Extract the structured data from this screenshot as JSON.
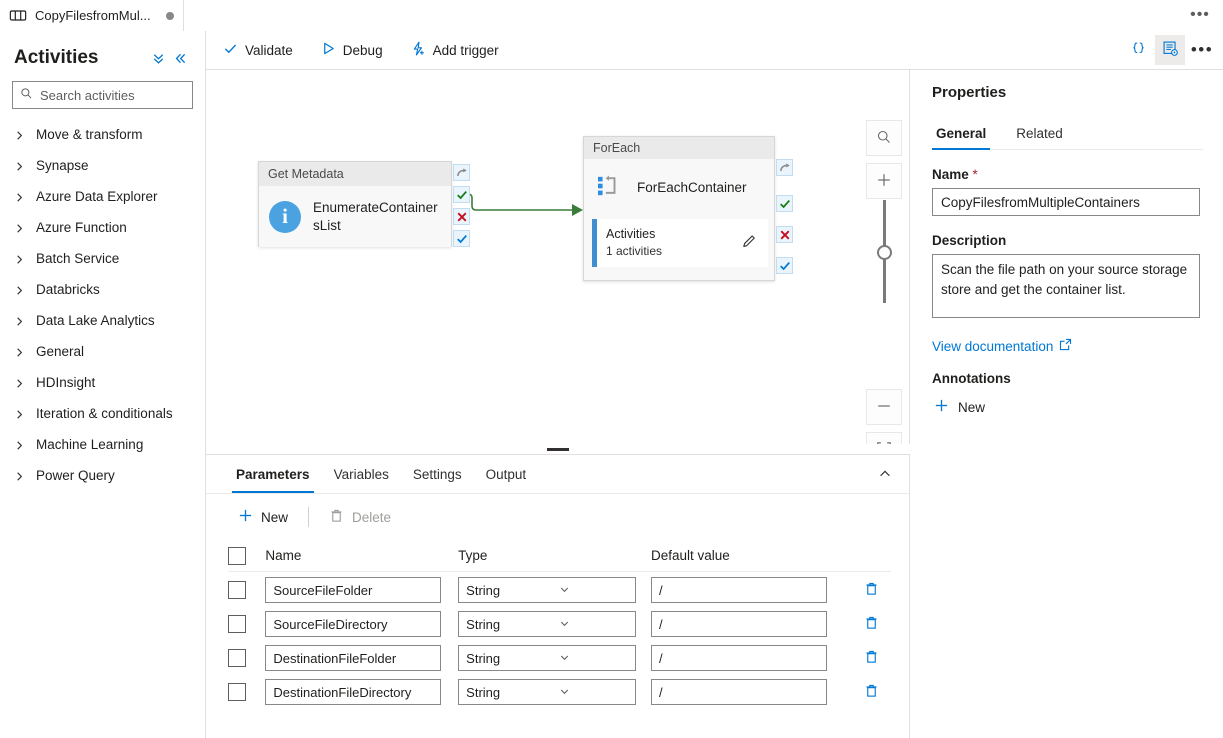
{
  "tab": {
    "title": "CopyFilesfromMul...",
    "icon": "pipeline-icon",
    "unsaved_indicator": "unsaved-dot",
    "more_label": "•••"
  },
  "sidebar": {
    "title": "Activities",
    "collapse_all_icon": "double-chevron-down-icon",
    "collapse_panel_icon": "double-chevron-left-icon",
    "search": {
      "placeholder": "Search activities",
      "value": "",
      "icon": "search-icon"
    },
    "items": [
      {
        "label": "Move & transform"
      },
      {
        "label": "Synapse"
      },
      {
        "label": "Azure Data Explorer"
      },
      {
        "label": "Azure Function"
      },
      {
        "label": "Batch Service"
      },
      {
        "label": "Databricks"
      },
      {
        "label": "Data Lake Analytics"
      },
      {
        "label": "General"
      },
      {
        "label": "HDInsight"
      },
      {
        "label": "Iteration & conditionals"
      },
      {
        "label": "Machine Learning"
      },
      {
        "label": "Power Query"
      }
    ]
  },
  "toolbar": {
    "validate_label": "Validate",
    "debug_label": "Debug",
    "add_trigger_label": "Add trigger",
    "code_icon": "curly-braces-icon",
    "properties_icon": "properties-panel-icon",
    "more_label": "•••"
  },
  "canvas": {
    "nodes": [
      {
        "type_label": "Get Metadata",
        "name": "EnumerateContainersList",
        "icon": "info-circle-icon"
      },
      {
        "type_label": "ForEach",
        "name": "ForEachContainer",
        "icon": "foreach-loop-icon",
        "sub_title": "Activities",
        "sub_count": "1 activities",
        "edit_icon": "pencil-icon"
      }
    ],
    "handles": {
      "skip": "skip-handle-icon",
      "success": "success-handle-icon",
      "failure": "failure-handle-icon",
      "completion": "completion-handle-icon"
    },
    "zoom_controls": {
      "search_icon": "zoom-search-icon",
      "zoom_in_icon": "zoom-in-icon",
      "zoom_out_icon": "zoom-out-icon",
      "fit_icon": "fit-to-screen-icon",
      "autoalign_icon": "auto-align-icon"
    }
  },
  "bottom_panel": {
    "tabs": [
      {
        "label": "Parameters",
        "selected": true
      },
      {
        "label": "Variables",
        "selected": false
      },
      {
        "label": "Settings",
        "selected": false
      },
      {
        "label": "Output",
        "selected": false
      }
    ],
    "collapse_icon": "chevron-up-icon",
    "commands": {
      "new_label": "New",
      "new_icon": "plus-icon",
      "delete_label": "Delete",
      "delete_icon": "trash-icon"
    },
    "table": {
      "headers": [
        "Name",
        "Type",
        "Default value"
      ],
      "rows": [
        {
          "name": "SourceFileFolder",
          "type": "String",
          "default": "/"
        },
        {
          "name": "SourceFileDirectory",
          "type": "String",
          "default": "/"
        },
        {
          "name": "DestinationFileFolder",
          "type": "String",
          "default": "/"
        },
        {
          "name": "DestinationFileDirectory",
          "type": "String",
          "default": "/"
        }
      ],
      "row_delete_icon": "trash-icon"
    }
  },
  "properties": {
    "title": "Properties",
    "tabs": [
      {
        "label": "General",
        "selected": true
      },
      {
        "label": "Related",
        "selected": false
      }
    ],
    "name_label": "Name",
    "name_required": "*",
    "name_value": "CopyFilesfromMultipleContainers",
    "description_label": "Description",
    "description_value": "Scan the file path on your source storage store and get the container list.",
    "doc_link_label": "View documentation",
    "doc_link_icon": "external-link-icon",
    "annotations_label": "Annotations",
    "annotation_new_label": "New",
    "annotation_new_icon": "plus-icon"
  },
  "colors": {
    "accent": "#0078d4",
    "success": "#107c10",
    "failure": "#c50f1f",
    "completion": "#0078d4",
    "required": "#a4262c",
    "connector": "#3a7d3a"
  }
}
